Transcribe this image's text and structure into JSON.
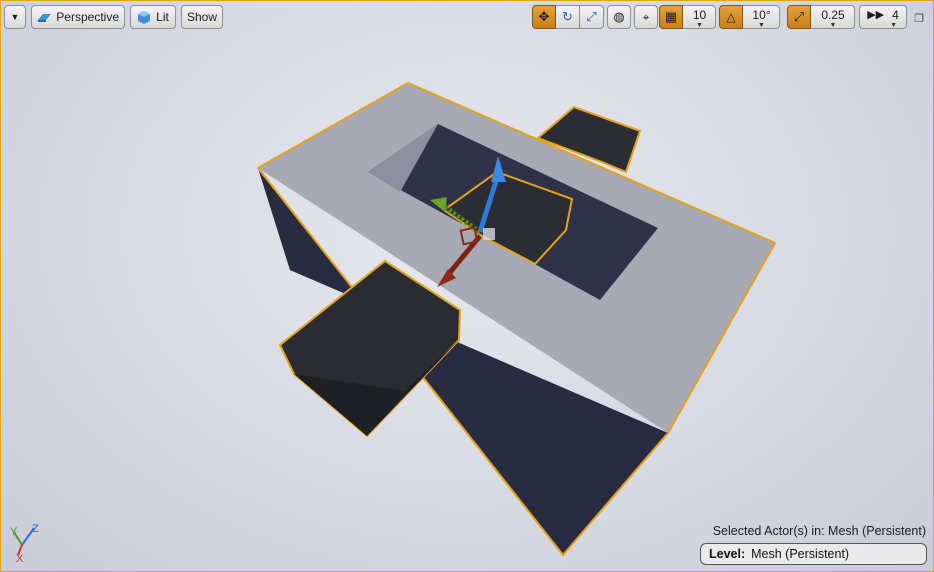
{
  "toolbar": {
    "view_mode": "Perspective",
    "lighting": "Lit",
    "show": "Show",
    "grid_snap": "10",
    "rotation_snap": "10°",
    "scale_snap": "0.25",
    "camera_speed": "4"
  },
  "status": {
    "selected_actors": "Selected Actor(s) in:  Mesh (Persistent)",
    "level_label": "Level:",
    "level_value": "Mesh (Persistent)"
  },
  "axis_labels": {
    "x": "X",
    "y": "Y",
    "z": "Z"
  },
  "colors": {
    "selection": "#e3a21a",
    "active_button": "#d08a25",
    "mesh_top": "#a5a7b4",
    "mesh_side": "#2c2f43",
    "block": "#2b2c31"
  },
  "icons": [
    "chevron-down-icon",
    "perspective-cube-icon",
    "lit-sphere-icon",
    "translate-icon",
    "rotate-icon",
    "scale-icon",
    "world-globe-icon",
    "surface-snap-icon",
    "grid-icon",
    "angle-icon",
    "scale-arrow-icon",
    "camera-speed-icon",
    "maximize-icon"
  ]
}
